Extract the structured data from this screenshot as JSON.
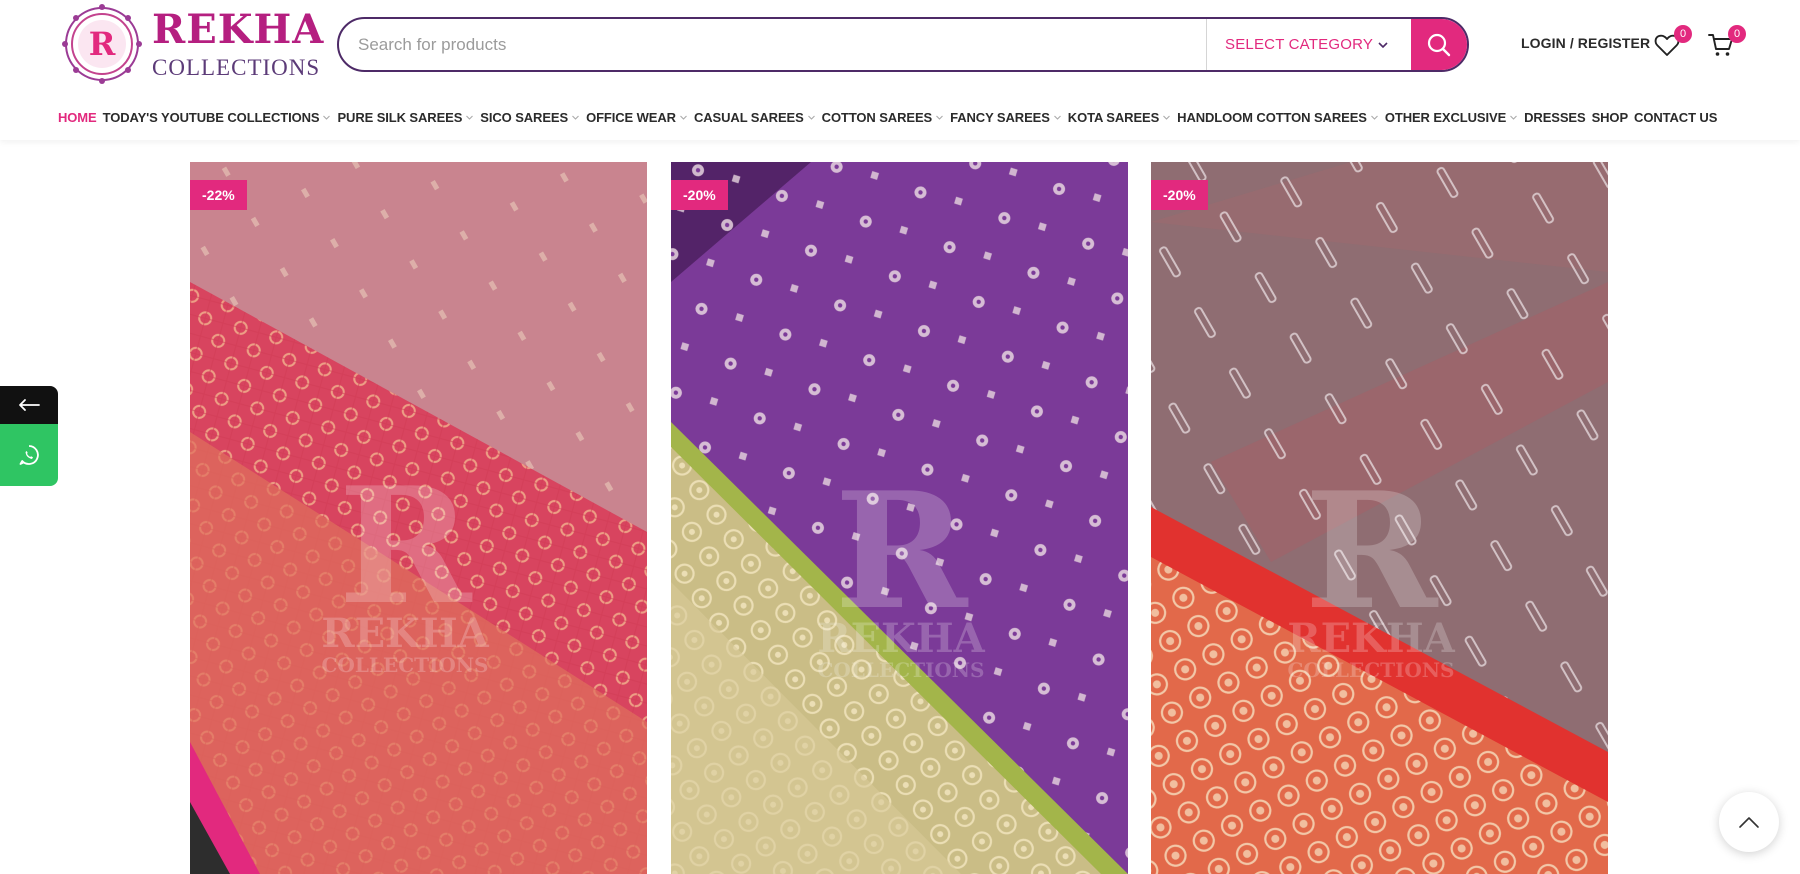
{
  "brand": {
    "name": "REKHA",
    "subtitle": "COLLECTIONS",
    "emblem_letter": "R"
  },
  "search": {
    "placeholder": "Search for products",
    "category_label": "SELECT CATEGORY"
  },
  "account": {
    "login_label": "LOGIN / REGISTER",
    "wishlist_count": "0",
    "cart_count": "0"
  },
  "nav": [
    {
      "label": "HOME",
      "dropdown": false,
      "active": true
    },
    {
      "label": "TODAY'S YOUTUBE COLLECTIONS",
      "dropdown": true
    },
    {
      "label": "PURE SILK SAREES",
      "dropdown": true
    },
    {
      "label": "SICO SAREES",
      "dropdown": true
    },
    {
      "label": "OFFICE WEAR",
      "dropdown": true
    },
    {
      "label": "CASUAL SAREES",
      "dropdown": true
    },
    {
      "label": "COTTON SAREES",
      "dropdown": true
    },
    {
      "label": "FANCY SAREES",
      "dropdown": true
    },
    {
      "label": "KOTA SAREES",
      "dropdown": true
    },
    {
      "label": "HANDLOOM COTTON SAREES",
      "dropdown": true
    },
    {
      "label": "OTHER EXCLUSIVE",
      "dropdown": true
    },
    {
      "label": "DRESSES",
      "dropdown": false
    },
    {
      "label": "SHOP",
      "dropdown": false
    },
    {
      "label": "CONTACT US",
      "dropdown": false
    }
  ],
  "products": [
    {
      "discount": "-22%",
      "body_color": "#c9848f",
      "border_color": "#e0523f",
      "accent_color": "#f0a58c"
    },
    {
      "discount": "-20%",
      "body_color": "#7b3a98",
      "border_color": "#a3b54a",
      "accent_color": "#e7d9a8"
    },
    {
      "discount": "-20%",
      "body_color": "#8f6d72",
      "border_color": "#e1322f",
      "accent_color": "#f3c7a7"
    }
  ],
  "watermark": {
    "letter": "R",
    "line1": "REKHA",
    "line2": "COLLECTIONS"
  },
  "colors": {
    "accent": "#e2297e",
    "brand_purple": "#4d2a67",
    "whatsapp": "#2fc563"
  },
  "icons": [
    "search-icon",
    "heart-icon",
    "cart-icon",
    "chevron-down-icon",
    "arrow-left-icon",
    "whatsapp-icon",
    "arrow-up-icon"
  ]
}
